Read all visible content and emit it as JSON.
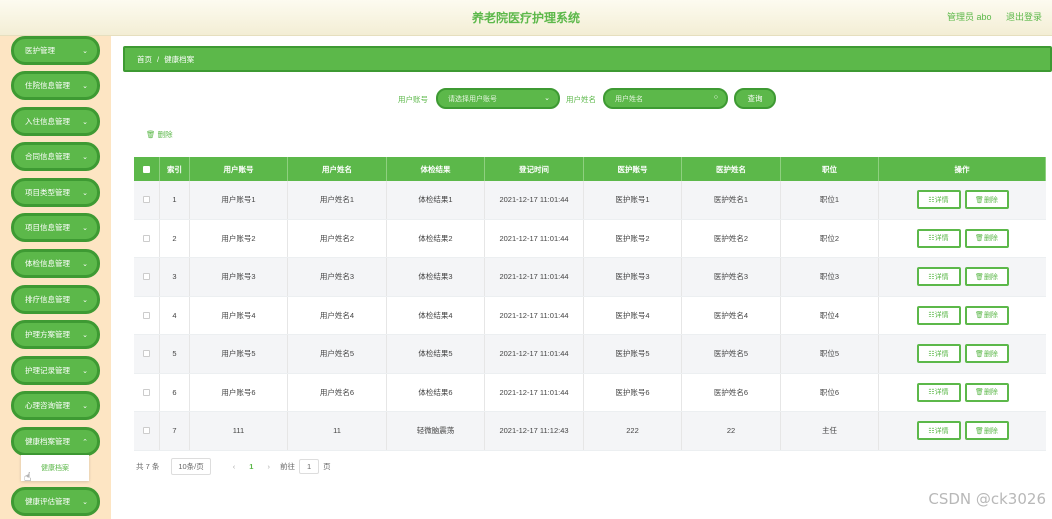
{
  "header": {
    "title": "养老院医疗护理系统",
    "user_label": "管理员 abo",
    "logout_label": "退出登录"
  },
  "sidebar": {
    "items": [
      {
        "label": "医护管理"
      },
      {
        "label": "住院信息管理"
      },
      {
        "label": "入住信息管理"
      },
      {
        "label": "合同信息管理"
      },
      {
        "label": "项目类型管理"
      },
      {
        "label": "项目信息管理"
      },
      {
        "label": "体检信息管理"
      },
      {
        "label": "排疗信息管理"
      },
      {
        "label": "护理方案管理"
      },
      {
        "label": "护理记录管理"
      },
      {
        "label": "心理咨询管理"
      },
      {
        "label": "健康档案管理"
      },
      {
        "label": "健康评估管理"
      }
    ],
    "submenu_label": "健康档案"
  },
  "breadcrumb": {
    "home": "首页",
    "separator": "/",
    "current": "健康档案"
  },
  "search": {
    "account_label": "用户账号",
    "account_placeholder": "请选择用户账号",
    "name_label": "用户姓名",
    "name_placeholder": "用户姓名",
    "button_label": "查询"
  },
  "toolbar": {
    "delete_label": "删除"
  },
  "table": {
    "columns": [
      "索引",
      "用户账号",
      "用户姓名",
      "体检结果",
      "登记时间",
      "医护账号",
      "医护姓名",
      "职位",
      "操作"
    ],
    "detail_label": "详情",
    "delete_label": "删除",
    "rows": [
      {
        "index": "1",
        "account": "用户账号1",
        "name": "用户姓名1",
        "result": "体检结果1",
        "time": "2021-12-17 11:01:44",
        "staff_account": "医护账号1",
        "staff_name": "医护姓名1",
        "position": "职位1"
      },
      {
        "index": "2",
        "account": "用户账号2",
        "name": "用户姓名2",
        "result": "体检结果2",
        "time": "2021-12-17 11:01:44",
        "staff_account": "医护账号2",
        "staff_name": "医护姓名2",
        "position": "职位2"
      },
      {
        "index": "3",
        "account": "用户账号3",
        "name": "用户姓名3",
        "result": "体检结果3",
        "time": "2021-12-17 11:01:44",
        "staff_account": "医护账号3",
        "staff_name": "医护姓名3",
        "position": "职位3"
      },
      {
        "index": "4",
        "account": "用户账号4",
        "name": "用户姓名4",
        "result": "体检结果4",
        "time": "2021-12-17 11:01:44",
        "staff_account": "医护账号4",
        "staff_name": "医护姓名4",
        "position": "职位4"
      },
      {
        "index": "5",
        "account": "用户账号5",
        "name": "用户姓名5",
        "result": "体检结果5",
        "time": "2021-12-17 11:01:44",
        "staff_account": "医护账号5",
        "staff_name": "医护姓名5",
        "position": "职位5"
      },
      {
        "index": "6",
        "account": "用户账号6",
        "name": "用户姓名6",
        "result": "体检结果6",
        "time": "2021-12-17 11:01:44",
        "staff_account": "医护账号6",
        "staff_name": "医护姓名6",
        "position": "职位6"
      },
      {
        "index": "7",
        "account": "111",
        "name": "11",
        "result": "轻微脑震荡",
        "time": "2021-12-17 11:12:43",
        "staff_account": "222",
        "staff_name": "22",
        "position": "主任"
      }
    ]
  },
  "pagination": {
    "total": "共 7 条",
    "page_size": "10条/页",
    "current_page": "1",
    "goto_prefix": "前往",
    "goto_value": "1",
    "goto_suffix": "页"
  },
  "watermark": "CSDN @ck3026",
  "colors": {
    "accent": "#5cb84a",
    "accent_dark": "#3e9a33",
    "sidebar_bg": "#fde5c3"
  }
}
